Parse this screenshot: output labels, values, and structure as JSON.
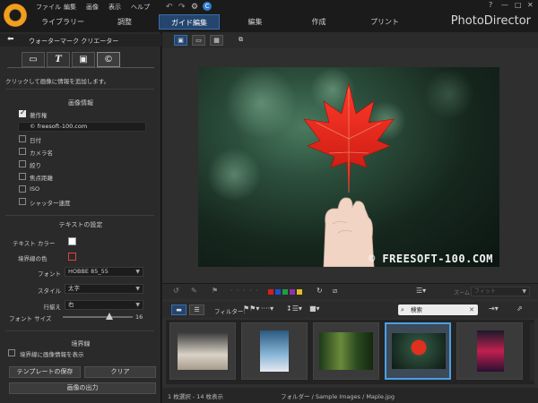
{
  "menu": {
    "items": [
      "ファイル",
      "編集",
      "画像",
      "表示",
      "ヘルプ"
    ],
    "undo_icon": "undo-icon",
    "redo_icon": "redo-icon",
    "settings_icon": "gear-icon",
    "account_icon": "account-icon",
    "window_controls": [
      "?",
      "—",
      "□",
      "✕"
    ]
  },
  "mode_tabs": [
    {
      "label": "ライブラリー",
      "active": false
    },
    {
      "label": "調整",
      "active": false
    },
    {
      "label": "ガイド編集",
      "active": true
    },
    {
      "label": "編集",
      "active": false
    },
    {
      "label": "作成",
      "active": false
    },
    {
      "label": "プリント",
      "active": false
    }
  ],
  "app_name": "PhotoDirector",
  "panel": {
    "title": "ウォーターマーク クリエーター",
    "tabs": [
      "▭",
      "T",
      "▣",
      "©"
    ],
    "hint": "クリックして画像に情報を追加します。",
    "image_info": {
      "title": "画像情報",
      "copyright": {
        "label": "著作権",
        "checked": true,
        "value": "© freesoft-100.com"
      },
      "options": [
        {
          "label": "日付",
          "checked": false
        },
        {
          "label": "カメラ名",
          "checked": false
        },
        {
          "label": "絞り",
          "checked": false
        },
        {
          "label": "焦点距離",
          "checked": false
        },
        {
          "label": "ISO",
          "checked": false
        },
        {
          "label": "シャッター速度",
          "checked": false
        }
      ]
    },
    "text_settings": {
      "title": "テキストの設定",
      "text_color_label": "テキスト カラー",
      "text_color": "#ffffff",
      "border_color_label": "境界線の色",
      "border_color": "#e04040",
      "font_label": "フォント",
      "font_value": "HOBBE 85_55",
      "style_label": "スタイル",
      "style_value": "太字",
      "align_label": "行揃え",
      "align_value": "右",
      "font_size_label": "フォント サイズ",
      "font_size_value": "16",
      "font_size_fraction": 0.67
    },
    "border": {
      "title": "境界線",
      "show_label": "境界線に画像情報を表示",
      "checked": false
    },
    "buttons": {
      "save_template": "テンプレートの保存",
      "clear": "クリア",
      "export": "画像の出力"
    }
  },
  "viewer": {
    "watermark": "© FREESOFT-100.COM"
  },
  "toolbar": {
    "flag_colors": [
      "#d02020",
      "#2050d0",
      "#20a040",
      "#9030b0",
      "#e0c020"
    ],
    "zoom_label": "ズーム",
    "zoom_value": "フィット"
  },
  "filterbar": {
    "filter_label": "フィルター:",
    "search_placeholder": "検索"
  },
  "status": {
    "selection": "1 枚選択 - 14 枚表示",
    "path": "フォルダー / Sample Images / Maple.jpg"
  }
}
